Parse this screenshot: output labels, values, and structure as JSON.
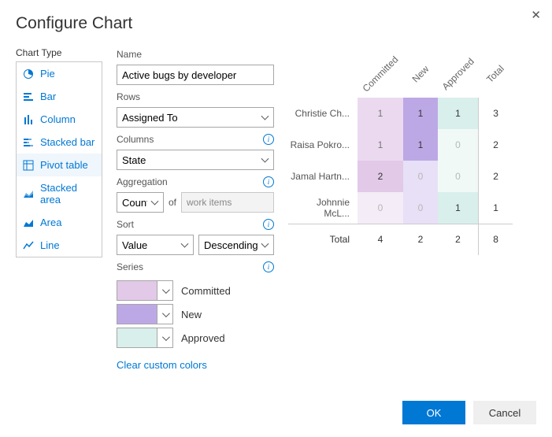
{
  "dialog": {
    "title": "Configure Chart",
    "chart_type_label": "Chart Type",
    "types": [
      "Pie",
      "Bar",
      "Column",
      "Stacked bar",
      "Pivot table",
      "Stacked area",
      "Area",
      "Line"
    ],
    "selected_type_index": 4
  },
  "form": {
    "name_label": "Name",
    "name_value": "Active bugs by developer",
    "rows_label": "Rows",
    "rows_value": "Assigned To",
    "columns_label": "Columns",
    "columns_value": "State",
    "aggregation_label": "Aggregation",
    "aggregation_value": "Count",
    "aggregation_of": "of",
    "aggregation_unit": "work items",
    "sort_label": "Sort",
    "sort_by": "Value",
    "sort_dir": "Descending",
    "series_label": "Series",
    "series": [
      {
        "label": "Committed",
        "color": "#e2c9e8"
      },
      {
        "label": "New",
        "color": "#bda8e6"
      },
      {
        "label": "Approved",
        "color": "#d9efeb"
      }
    ],
    "clear_colors": "Clear custom colors"
  },
  "preview": {
    "columns": [
      "Committed",
      "New",
      "Approved",
      "Total"
    ],
    "rows": [
      {
        "name": "Christie Ch...",
        "cells": [
          1,
          1,
          1
        ],
        "total": 3
      },
      {
        "name": "Raisa Pokro...",
        "cells": [
          1,
          1,
          0
        ],
        "total": 2
      },
      {
        "name": "Jamal Hartn...",
        "cells": [
          2,
          0,
          0
        ],
        "total": 2
      },
      {
        "name": "Johnnie McL...",
        "cells": [
          0,
          0,
          1
        ],
        "total": 1
      }
    ],
    "total_label": "Total",
    "col_totals": [
      4,
      2,
      2,
      8
    ],
    "series_colors": [
      "#e2c9e8",
      "#bda8e6",
      "#d9efeb"
    ],
    "max_by_col": [
      2,
      1,
      1
    ]
  },
  "footer": {
    "ok": "OK",
    "cancel": "Cancel"
  },
  "chart_data": {
    "type": "table",
    "title": "Active bugs by developer",
    "row_field": "Assigned To",
    "col_field": "State",
    "aggregation": "Count of work items",
    "columns": [
      "Committed",
      "New",
      "Approved"
    ],
    "rows": [
      "Christie Ch...",
      "Raisa Pokro...",
      "Jamal Hartn...",
      "Johnnie McL..."
    ],
    "values": [
      [
        1,
        1,
        1
      ],
      [
        1,
        1,
        0
      ],
      [
        2,
        0,
        0
      ],
      [
        0,
        0,
        1
      ]
    ],
    "row_totals": [
      3,
      2,
      2,
      1
    ],
    "col_totals": [
      4,
      2,
      2
    ],
    "grand_total": 8
  }
}
